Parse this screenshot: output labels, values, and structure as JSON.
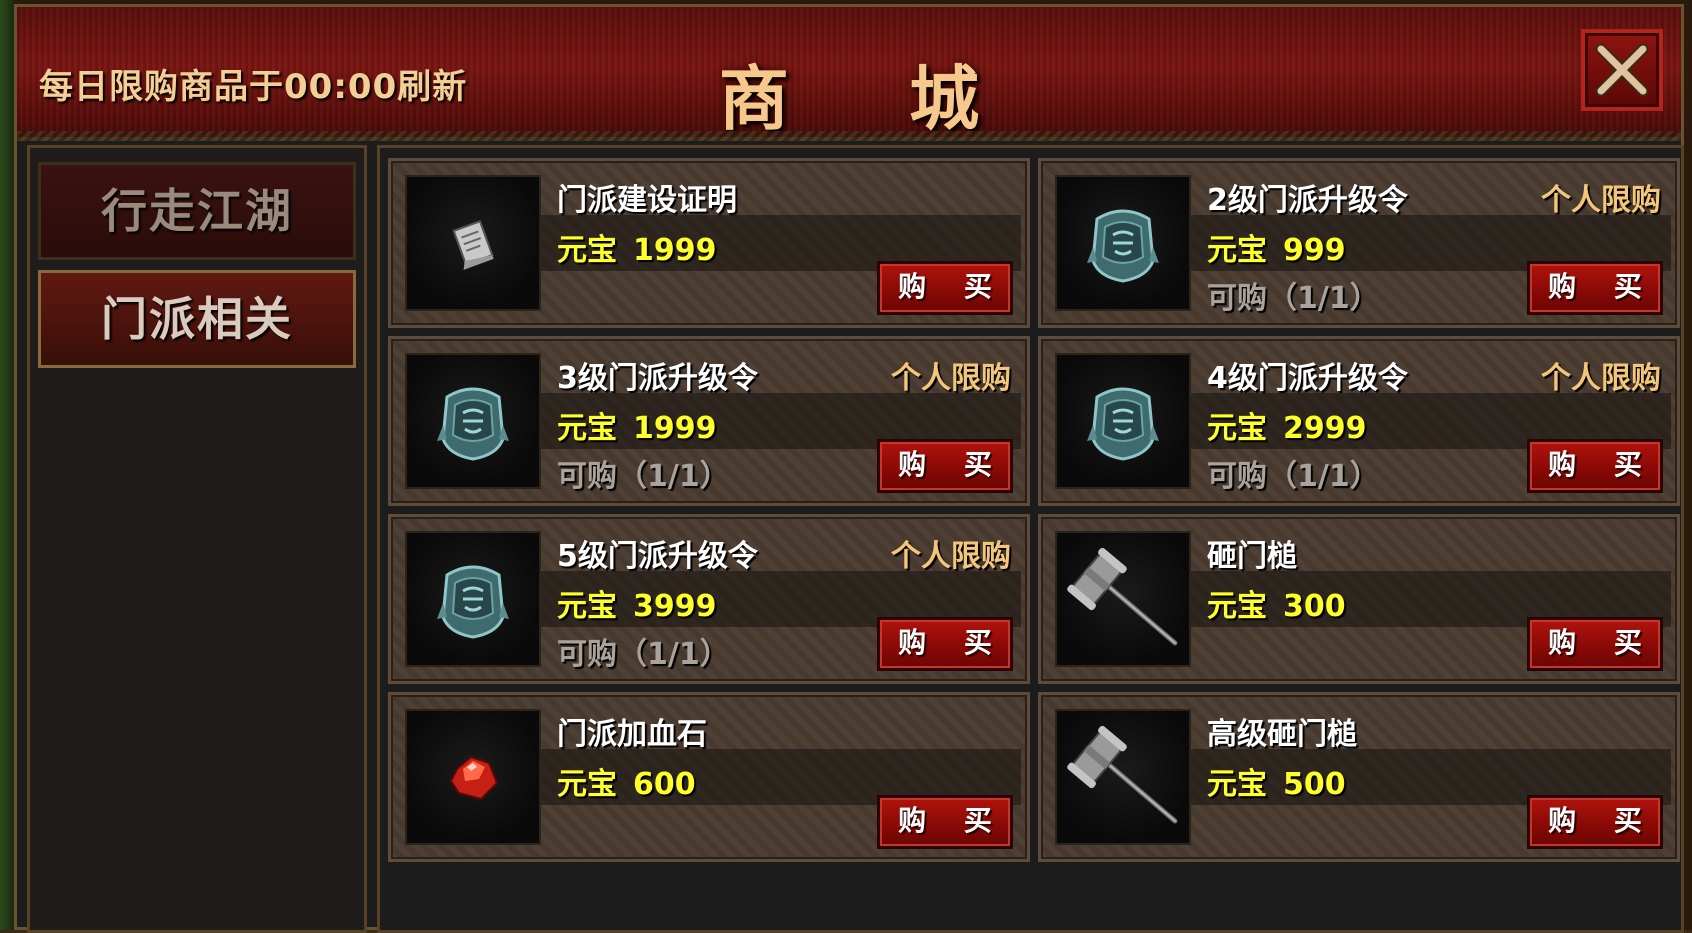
{
  "header": {
    "notice": "每日限购商品于00:00刷新",
    "title": "商 城"
  },
  "sidebar": {
    "tabs": [
      {
        "label": "行走江湖",
        "active": false
      },
      {
        "label": "门派相关",
        "active": true
      }
    ]
  },
  "shop": {
    "currency": "元宝",
    "buy_label": "购 买",
    "items": [
      {
        "name": "门派建设证明",
        "price": "1999",
        "limit": "",
        "quota": "",
        "icon": "certificate-icon"
      },
      {
        "name": "2级门派升级令",
        "price": "999",
        "limit": "个人限购",
        "quota": "可购（1/1）",
        "icon": "sect-token-icon"
      },
      {
        "name": "3级门派升级令",
        "price": "1999",
        "limit": "个人限购",
        "quota": "可购（1/1）",
        "icon": "sect-token-icon"
      },
      {
        "name": "4级门派升级令",
        "price": "2999",
        "limit": "个人限购",
        "quota": "可购（1/1）",
        "icon": "sect-token-icon"
      },
      {
        "name": "5级门派升级令",
        "price": "3999",
        "limit": "个人限购",
        "quota": "可购（1/1）",
        "icon": "sect-token-icon"
      },
      {
        "name": "砸门槌",
        "price": "300",
        "limit": "",
        "quota": "",
        "icon": "hammer-icon"
      },
      {
        "name": "门派加血石",
        "price": "600",
        "limit": "",
        "quota": "",
        "icon": "red-gem-icon"
      },
      {
        "name": "高级砸门槌",
        "price": "500",
        "limit": "",
        "quota": "",
        "icon": "hammer-icon"
      }
    ]
  },
  "colors": {
    "price": "#ffff2a",
    "limit": "#f3c679",
    "buy_button": "#a10f0a",
    "header": "#6a1410"
  }
}
